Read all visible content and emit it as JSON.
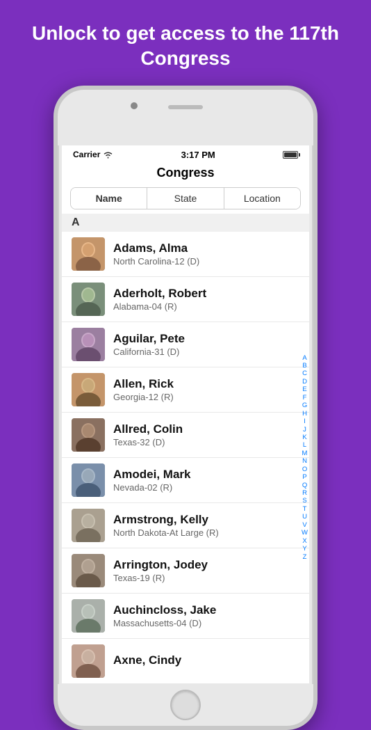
{
  "header": {
    "title": "Unlock to get access to the 117th Congress"
  },
  "status_bar": {
    "carrier": "Carrier",
    "time": "3:17 PM"
  },
  "nav": {
    "title": "Congress"
  },
  "segments": [
    {
      "label": "Name",
      "active": true
    },
    {
      "label": "State",
      "active": false
    },
    {
      "label": "Location",
      "active": false
    }
  ],
  "section_a_label": "A",
  "members": [
    {
      "id": 1,
      "name": "Adams, Alma",
      "district": "North Carolina-12 (D)",
      "avatar_class": "av-1"
    },
    {
      "id": 2,
      "name": "Aderholt, Robert",
      "district": "Alabama-04 (R)",
      "avatar_class": "av-2"
    },
    {
      "id": 3,
      "name": "Aguilar, Pete",
      "district": "California-31 (D)",
      "avatar_class": "av-3"
    },
    {
      "id": 4,
      "name": "Allen, Rick",
      "district": "Georgia-12 (R)",
      "avatar_class": "av-4"
    },
    {
      "id": 5,
      "name": "Allred, Colin",
      "district": "Texas-32 (D)",
      "avatar_class": "av-5"
    },
    {
      "id": 6,
      "name": "Amodei, Mark",
      "district": "Nevada-02 (R)",
      "avatar_class": "av-6"
    },
    {
      "id": 7,
      "name": "Armstrong, Kelly",
      "district": "North Dakota-At Large (R)",
      "avatar_class": "av-7"
    },
    {
      "id": 8,
      "name": "Arrington, Jodey",
      "district": "Texas-19 (R)",
      "avatar_class": "av-8"
    },
    {
      "id": 9,
      "name": "Auchincloss, Jake",
      "district": "Massachusetts-04 (D)",
      "avatar_class": "av-9"
    },
    {
      "id": 10,
      "name": "Axne, Cindy",
      "district": "",
      "avatar_class": "av-10"
    }
  ],
  "alpha_index": [
    "A",
    "B",
    "C",
    "D",
    "E",
    "F",
    "G",
    "H",
    "I",
    "J",
    "K",
    "L",
    "M",
    "N",
    "O",
    "P",
    "Q",
    "R",
    "S",
    "T",
    "U",
    "V",
    "W",
    "X",
    "Y",
    "Z"
  ]
}
